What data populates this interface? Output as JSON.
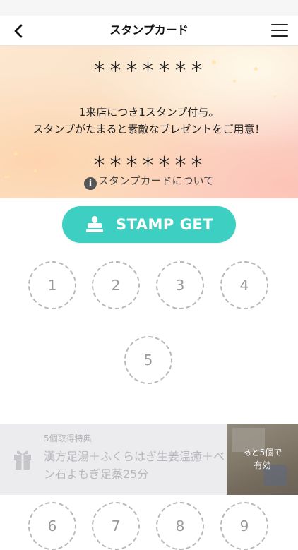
{
  "header": {
    "title": "スタンプカード"
  },
  "hero": {
    "stars_top": "＊＊＊＊＊＊＊",
    "message_line1": "1来店につき1スタンプ付与。",
    "message_line2": "スタンプがたまると素敵なプレゼントをご用意！",
    "stars_bottom": "＊＊＊＊＊＊＊",
    "about_link": "スタンプカードについて"
  },
  "stamp_button": {
    "label": "STAMP GET"
  },
  "stamps": {
    "row1": [
      "1",
      "2",
      "3",
      "4"
    ],
    "row2": [
      "5"
    ],
    "row3": [
      "6",
      "7",
      "8",
      "9"
    ]
  },
  "bonus": {
    "heading": "5個取得特典",
    "description": "漢方足湯＋ふくらはぎ生姜温癒＋ベン石よもぎ足蒸25分",
    "thumb_line1": "あと5個で",
    "thumb_line2": "有効"
  },
  "colors": {
    "accent": "#3dcfc2",
    "slot_border": "#b8b8b8",
    "bonus_bg": "#ececef"
  }
}
